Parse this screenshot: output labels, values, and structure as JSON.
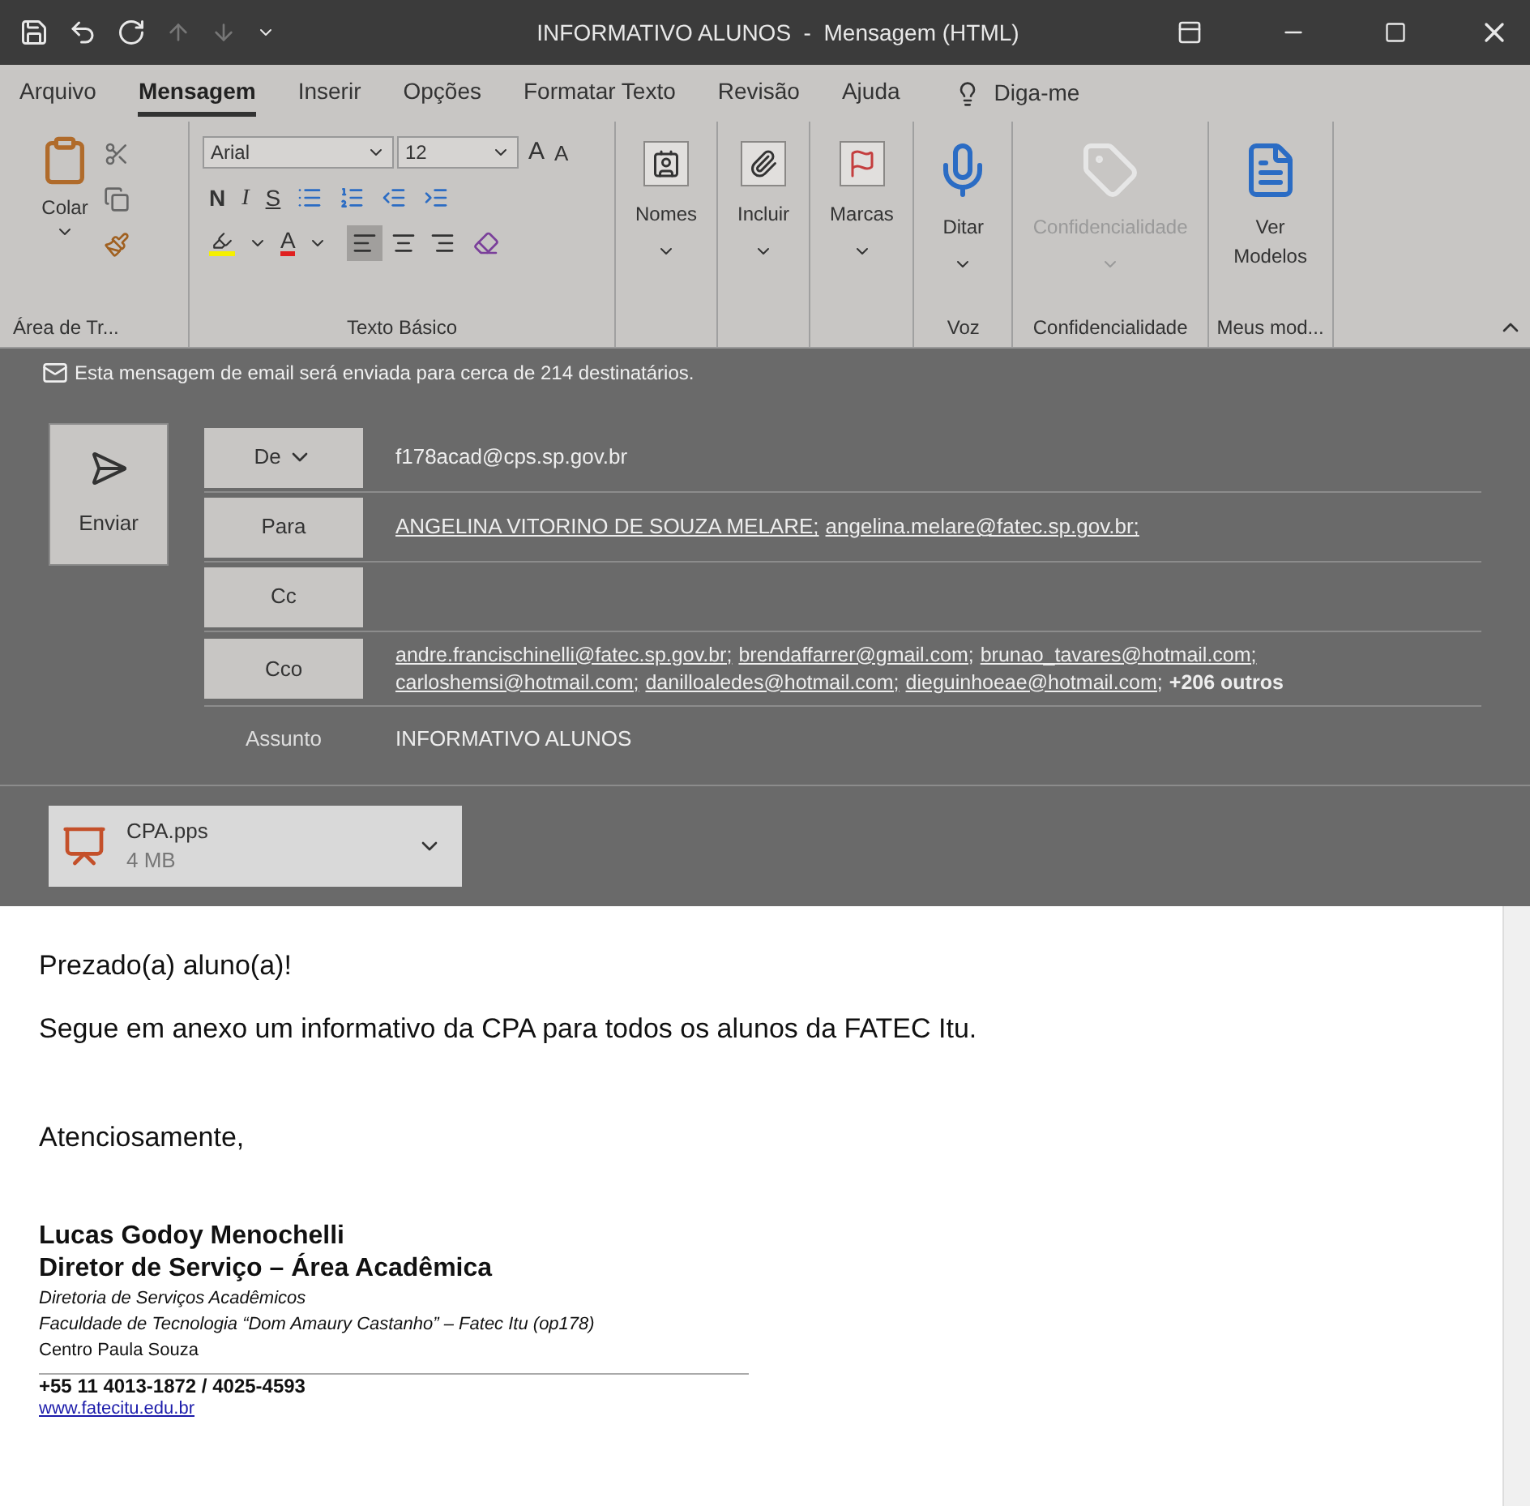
{
  "window": {
    "title": "INFORMATIVO ALUNOS  -  Mensagem (HTML)"
  },
  "tabs": [
    {
      "label": "Arquivo",
      "selected": false
    },
    {
      "label": "Mensagem",
      "selected": true
    },
    {
      "label": "Inserir",
      "selected": false
    },
    {
      "label": "Opções",
      "selected": false
    },
    {
      "label": "Formatar Texto",
      "selected": false
    },
    {
      "label": "Revisão",
      "selected": false
    },
    {
      "label": "Ajuda",
      "selected": false
    }
  ],
  "tell_me": "Diga-me",
  "ribbon": {
    "clipboard": {
      "paste": "Colar",
      "group": "Área de Tr..."
    },
    "font": {
      "family": "Arial",
      "size": "12",
      "grow": "A",
      "shrink": "A",
      "font_color_glyph": "A",
      "bold": "N",
      "italic": "I",
      "underline": "S",
      "group": "Texto Básico",
      "alignments": [
        {
          "kind": "left",
          "selected": true
        },
        {
          "kind": "center",
          "selected": false
        },
        {
          "kind": "right",
          "selected": false
        }
      ]
    },
    "groups": [
      {
        "kind": "names",
        "label": "Nomes",
        "disabled": false
      },
      {
        "kind": "attach",
        "label": "Incluir",
        "disabled": false
      },
      {
        "kind": "flag",
        "label": "Marcas",
        "disabled": false
      },
      {
        "kind": "mic",
        "label": "Ditar",
        "group": "Voz",
        "disabled": false
      },
      {
        "kind": "tag",
        "label": "Confidencialidade",
        "group": "Confidencialidade",
        "disabled": true
      },
      {
        "kind": "templates",
        "label": "Ver Modelos",
        "group": "Meus mod...",
        "disabled": false
      }
    ]
  },
  "info": "Esta mensagem de email será enviada para cerca de 214 destinatários.",
  "send": "Enviar",
  "from": {
    "button": "De",
    "value": "f178acad@cps.sp.gov.br"
  },
  "to": {
    "button": "Para",
    "recipients": [
      "ANGELINA VITORINO DE SOUZA MELARE;",
      "angelina.melare@fatec.sp.gov.br;"
    ]
  },
  "cc": {
    "button": "Cc"
  },
  "bcc": {
    "button": "Cco",
    "recipients": [
      "andre.francischinelli@fatec.sp.gov.br;",
      "brendaffarrer@gmail.com;",
      "brunao_tavares@hotmail.com;",
      "carloshemsi@hotmail.com;",
      "danilloaledes@hotmail.com;",
      "dieguinhoeae@hotmail.com;"
    ],
    "more": "+206 outros"
  },
  "subject": {
    "label": "Assunto",
    "value": "INFORMATIVO ALUNOS"
  },
  "attachment": {
    "name": "CPA.pps",
    "size": "4 MB"
  },
  "body": {
    "paragraphs": [
      "Prezado(a) aluno(a)!",
      "Segue em anexo um informativo da CPA para todos os alunos da FATEC Itu.",
      "Atenciosamente,"
    ],
    "signature": {
      "name": "Lucas Godoy Menochelli",
      "role": "Diretor de Serviço – Área Acadêmica",
      "lines": [
        {
          "kind": "italic",
          "text": "Diretoria de Serviços Acadêmicos"
        },
        {
          "kind": "italic",
          "text": "Faculdade de Tecnologia “Dom Amaury Castanho” – Fatec Itu (op178)"
        },
        {
          "kind": "plain",
          "text": "Centro Paula Souza"
        }
      ],
      "phone": "+55 11 4013-1872 / 4025-4593",
      "website": "www.fatecitu.edu.br"
    }
  }
}
